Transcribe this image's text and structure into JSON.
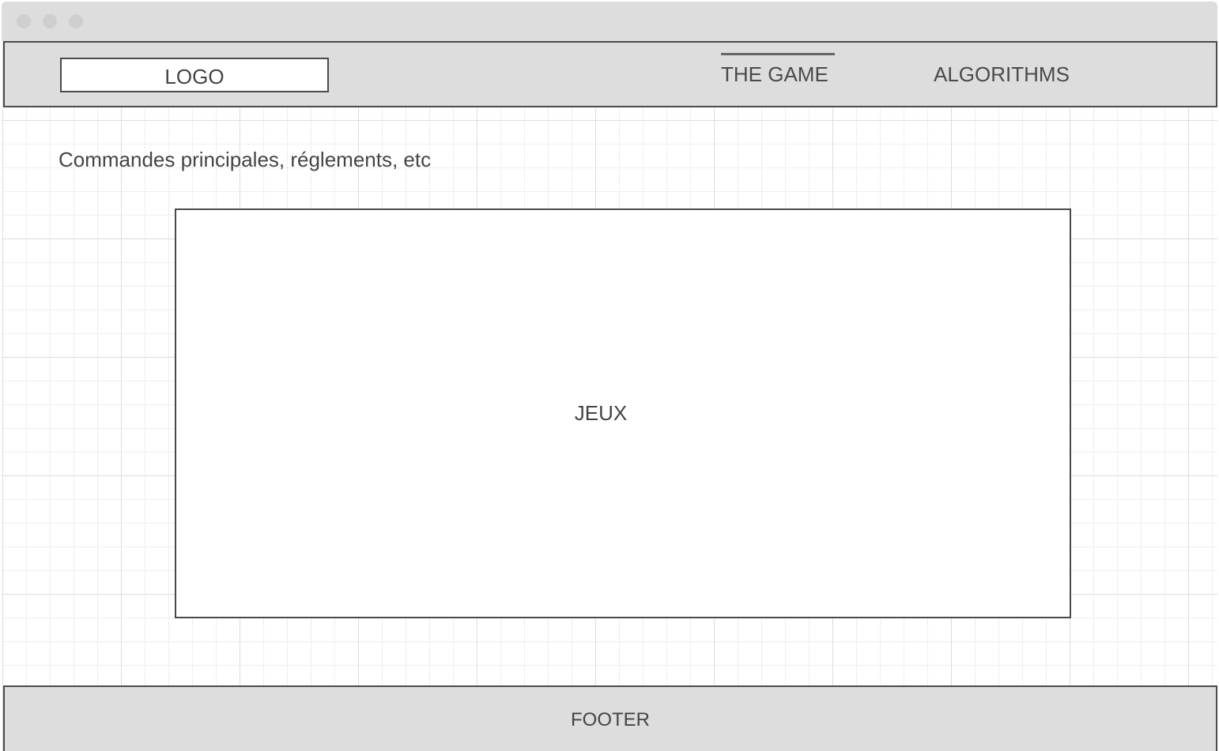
{
  "header": {
    "logo": "LOGO",
    "nav": [
      {
        "label": "THE GAME",
        "active": true
      },
      {
        "label": "ALGORITHMS",
        "active": false
      }
    ]
  },
  "main": {
    "intro": "Commandes principales, réglements, etc",
    "game_panel_label": "JEUX"
  },
  "footer": {
    "label": "FOOTER"
  },
  "colors": {
    "chrome": "#dddddd",
    "border": "#4a4a4a",
    "text": "#444444"
  }
}
